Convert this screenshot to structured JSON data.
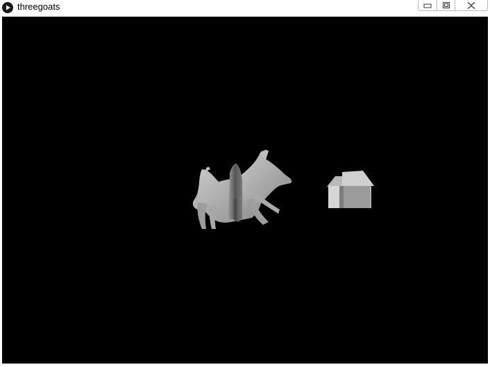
{
  "window": {
    "title": "threegoats",
    "app_icon": "play-icon",
    "controls": {
      "minimize_icon": "minimize-icon",
      "maximize_icon": "maximize-icon",
      "close_icon": "close-icon"
    }
  },
  "scene": {
    "background": "#000000",
    "objects": [
      {
        "name": "goat-model",
        "color": "#a6a6a6"
      },
      {
        "name": "house-model",
        "color": "#b4b4b4"
      }
    ]
  }
}
